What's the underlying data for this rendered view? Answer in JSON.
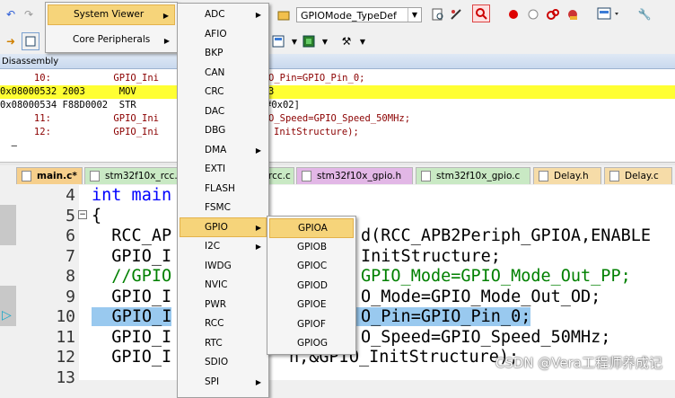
{
  "toolbar": {
    "target_combo": "GPIOMode_TypeDef"
  },
  "disassembly": {
    "title": "Disassembly",
    "lines": [
      {
        "text": "      10:           GPIO_Ini",
        "rest": "O_Pin=GPIO_Pin_0;",
        "kind": "src"
      },
      {
        "text": "0x08000532 2003      MOV",
        "rest": "3",
        "kind": "current"
      },
      {
        "text": "0x08000534 F88D0002  STR",
        "rest": "#0x02]",
        "kind": "asm"
      },
      {
        "text": "      11:           GPIO_Ini",
        "rest": "O_Speed=GPIO_Speed_50MHz;",
        "kind": "src"
      },
      {
        "text": "      12:           GPIO_Ini",
        "rest": "InitStructure);",
        "kind": "src"
      },
      {
        "text": "  —",
        "rest": "",
        "kind": "asm"
      }
    ]
  },
  "tabs": [
    {
      "label": "main.c*",
      "active": true
    },
    {
      "label": "stm32f10x_rcc.c",
      "active": false
    },
    {
      "label": "rcc.c",
      "active": false
    },
    {
      "label": "stm32f10x_gpio.h",
      "active": false
    },
    {
      "label": "stm32f10x_gpio.c",
      "active": false
    },
    {
      "label": "Delay.h",
      "active": false
    },
    {
      "label": "Delay.c",
      "active": false
    }
  ],
  "editor": {
    "lines": [
      {
        "num": "4",
        "code": "int main",
        "kind": "kwline"
      },
      {
        "num": "5",
        "code": "{",
        "kind": "plain"
      },
      {
        "num": "6",
        "code": "  RCC_AP",
        "tail": "d(RCC_APB2Periph_GPIOA,ENABLE",
        "kind": "plain"
      },
      {
        "num": "7",
        "code": "  GPIO_I",
        "tail": "InitStructure;",
        "kind": "plain"
      },
      {
        "num": "8",
        "code": "  //GPIO",
        "tail": "GPIO_Mode=GPIO_Mode_Out_PP;",
        "kind": "comment"
      },
      {
        "num": "9",
        "code": "  GPIO_I",
        "tail": "O_Mode=GPIO_Mode_Out_OD;",
        "kind": "plain"
      },
      {
        "num": "10",
        "code": "  GPIO_I",
        "tail": "O_Pin=GPIO_Pin_0;",
        "kind": "selected"
      },
      {
        "num": "11",
        "code": "  GPIO_I",
        "tail": "O_Speed=GPIO_Speed_50MHz;",
        "kind": "plain"
      },
      {
        "num": "12",
        "code": "  GPIO_I",
        "tail": "n,&GPIO_InitStructure);",
        "kind": "plain"
      },
      {
        "num": "13",
        "code": "",
        "tail": "",
        "kind": "plain"
      }
    ]
  },
  "menu1": {
    "items": [
      {
        "label": "System Viewer",
        "hot": true
      },
      {
        "label": "Core Peripherals",
        "hot": false
      }
    ]
  },
  "menu2": {
    "items": [
      "ADC",
      "AFIO",
      "BKP",
      "CAN",
      "CRC",
      "DAC",
      "DBG",
      "DMA",
      "EXTI",
      "FLASH",
      "FSMC",
      "GPIO",
      "I2C",
      "IWDG",
      "NVIC",
      "PWR",
      "RCC",
      "RTC",
      "SDIO",
      "SPI"
    ],
    "submenu": [
      "ADC",
      "DMA",
      "GPIO",
      "I2C"
    ],
    "hot": "GPIO"
  },
  "menu3": {
    "items": [
      "GPIOA",
      "GPIOB",
      "GPIOC",
      "GPIOD",
      "GPIOE",
      "GPIOF",
      "GPIOG"
    ],
    "hot": "GPIOA"
  },
  "watermark": "CSDN @Vera工程师养成记",
  "colors": {
    "current_line": "#ffff33",
    "selection": "#99c9ef",
    "menu_highlight": "#f6d47a",
    "keyword": "#0000ff",
    "comment": "#008000"
  }
}
